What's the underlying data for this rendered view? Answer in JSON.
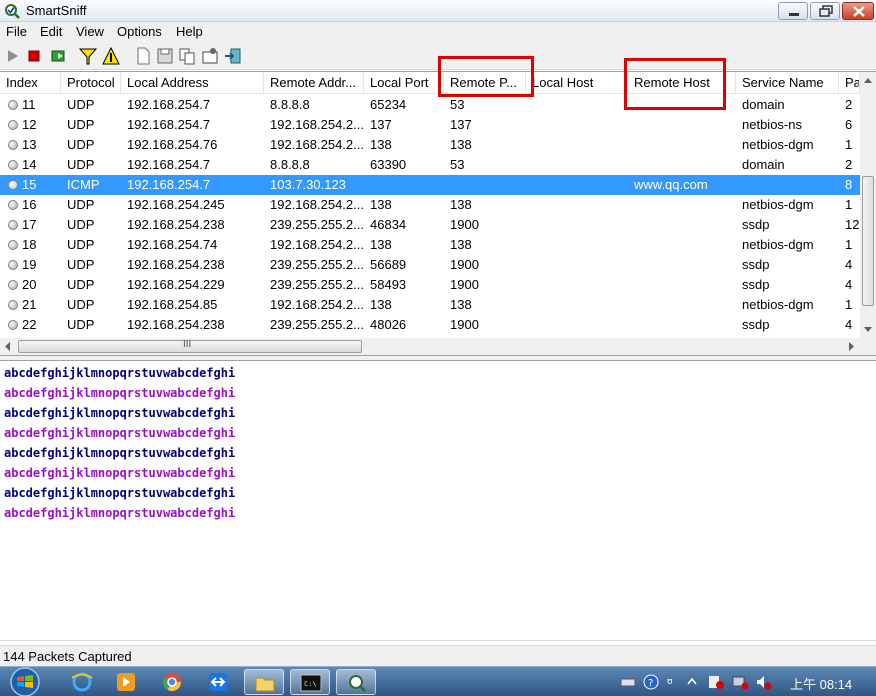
{
  "window": {
    "title": "SmartSniff"
  },
  "menu": {
    "file": "File",
    "edit": "Edit",
    "view": "View",
    "options": "Options",
    "help": "Help"
  },
  "columns": {
    "index": "Index",
    "protocol": "Protocol",
    "local_address": "Local Address",
    "remote_address": "Remote Addr...",
    "local_port": "Local Port",
    "remote_port": "Remote P...",
    "local_host": "Local Host",
    "remote_host": "Remote Host",
    "service_name": "Service Name",
    "packets": "Pa"
  },
  "rows": [
    {
      "index": "11",
      "protocol": "UDP",
      "local_address": "192.168.254.7",
      "remote_address": "8.8.8.8",
      "local_port": "65234",
      "remote_port": "53",
      "local_host": "",
      "remote_host": "",
      "service_name": "domain",
      "packets": "2"
    },
    {
      "index": "12",
      "protocol": "UDP",
      "local_address": "192.168.254.7",
      "remote_address": "192.168.254.2...",
      "local_port": "137",
      "remote_port": "137",
      "local_host": "",
      "remote_host": "",
      "service_name": "netbios-ns",
      "packets": "6"
    },
    {
      "index": "13",
      "protocol": "UDP",
      "local_address": "192.168.254.76",
      "remote_address": "192.168.254.2...",
      "local_port": "138",
      "remote_port": "138",
      "local_host": "",
      "remote_host": "",
      "service_name": "netbios-dgm",
      "packets": "1"
    },
    {
      "index": "14",
      "protocol": "UDP",
      "local_address": "192.168.254.7",
      "remote_address": "8.8.8.8",
      "local_port": "63390",
      "remote_port": "53",
      "local_host": "",
      "remote_host": "",
      "service_name": "domain",
      "packets": "2"
    },
    {
      "index": "15",
      "protocol": "ICMP",
      "local_address": "192.168.254.7",
      "remote_address": "103.7.30.123",
      "local_port": "",
      "remote_port": "",
      "local_host": "",
      "remote_host": "www.qq.com",
      "service_name": "",
      "packets": "8"
    },
    {
      "index": "16",
      "protocol": "UDP",
      "local_address": "192.168.254.245",
      "remote_address": "192.168.254.2...",
      "local_port": "138",
      "remote_port": "138",
      "local_host": "",
      "remote_host": "",
      "service_name": "netbios-dgm",
      "packets": "1"
    },
    {
      "index": "17",
      "protocol": "UDP",
      "local_address": "192.168.254.238",
      "remote_address": "239.255.255.2...",
      "local_port": "46834",
      "remote_port": "1900",
      "local_host": "",
      "remote_host": "",
      "service_name": "ssdp",
      "packets": "12"
    },
    {
      "index": "18",
      "protocol": "UDP",
      "local_address": "192.168.254.74",
      "remote_address": "192.168.254.2...",
      "local_port": "138",
      "remote_port": "138",
      "local_host": "",
      "remote_host": "",
      "service_name": "netbios-dgm",
      "packets": "1"
    },
    {
      "index": "19",
      "protocol": "UDP",
      "local_address": "192.168.254.238",
      "remote_address": "239.255.255.2...",
      "local_port": "56689",
      "remote_port": "1900",
      "local_host": "",
      "remote_host": "",
      "service_name": "ssdp",
      "packets": "4"
    },
    {
      "index": "20",
      "protocol": "UDP",
      "local_address": "192.168.254.229",
      "remote_address": "239.255.255.2...",
      "local_port": "58493",
      "remote_port": "1900",
      "local_host": "",
      "remote_host": "",
      "service_name": "ssdp",
      "packets": "4"
    },
    {
      "index": "21",
      "protocol": "UDP",
      "local_address": "192.168.254.85",
      "remote_address": "192.168.254.2...",
      "local_port": "138",
      "remote_port": "138",
      "local_host": "",
      "remote_host": "",
      "service_name": "netbios-dgm",
      "packets": "1"
    },
    {
      "index": "22",
      "protocol": "UDP",
      "local_address": "192.168.254.238",
      "remote_address": "239.255.255.2...",
      "local_port": "48026",
      "remote_port": "1900",
      "local_host": "",
      "remote_host": "",
      "service_name": "ssdp",
      "packets": "4"
    }
  ],
  "selected_row_index": "15",
  "hscroll_label": "III",
  "payload_lines": [
    "abcdefghijklmnopqrstuvwabcdefghi",
    "abcdefghijklmnopqrstuvwabcdefghi",
    "abcdefghijklmnopqrstuvwabcdefghi",
    "abcdefghijklmnopqrstuvwabcdefghi",
    "abcdefghijklmnopqrstuvwabcdefghi",
    "abcdefghijklmnopqrstuvwabcdefghi",
    "abcdefghijklmnopqrstuvwabcdefghi",
    "abcdefghijklmnopqrstuvwabcdefghi"
  ],
  "payload_colors": {
    "outgoing": "#000080",
    "incoming": "#9b10c8"
  },
  "status": {
    "packets_captured": "144 Packets Captured"
  },
  "taskbar": {
    "clock": "上午 08:14"
  },
  "colors": {
    "selection": "#3399ff",
    "annotation": "#e00000"
  },
  "icons": {
    "toolbar": [
      "play-icon",
      "stop-icon",
      "capture-options-icon",
      "filter-icon",
      "display-filter-icon",
      "new-icon",
      "save-icon",
      "copy-icon",
      "properties-icon",
      "exit-icon"
    ]
  }
}
